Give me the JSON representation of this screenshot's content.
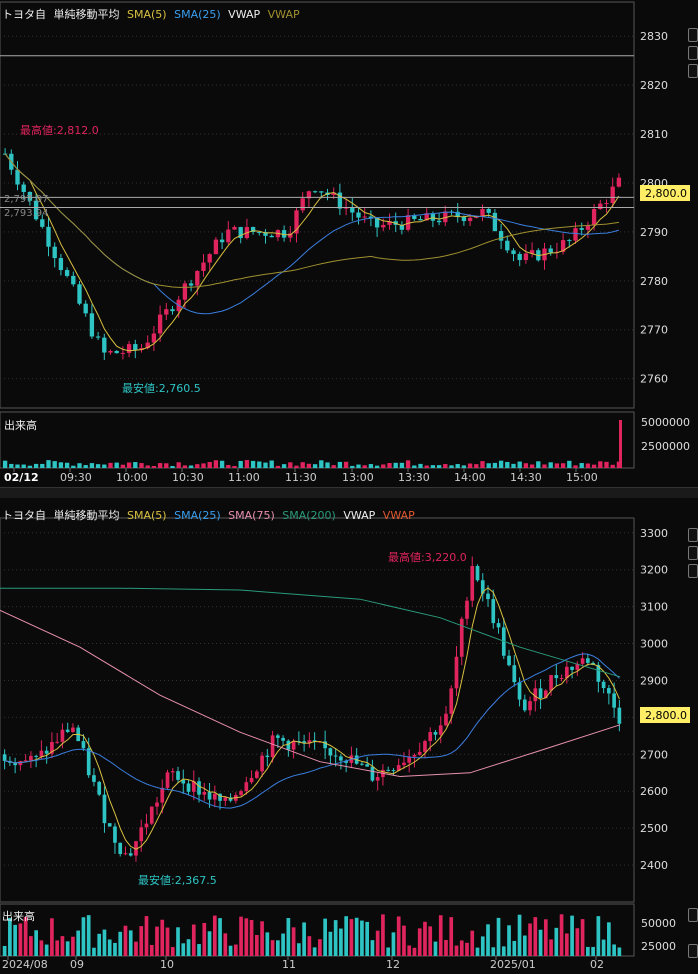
{
  "intraday": {
    "header": {
      "symbol": "トヨタ自",
      "indicator_group": "単純移動平均",
      "sma5": "SMA(5)",
      "sma25": "SMA(25)",
      "vwap1": "VWAP",
      "vwap2": "VWAP"
    },
    "price_ticks": [
      "2830",
      "2820",
      "2810",
      "2800",
      "2790",
      "2780",
      "2770",
      "2760"
    ],
    "current_price": "2,800.0",
    "high_label": "最高値:2,812.0",
    "low_label": "最安値:2,760.5",
    "line_label_1": "2,797.07",
    "line_label_2": "2,793.94",
    "volume_title": "出来高",
    "volume_ticks": [
      "5000000",
      "2500000"
    ],
    "time_ticks": [
      "02/12",
      "09:30",
      "10:00",
      "10:30",
      "11:00",
      "11:30",
      "13:00",
      "13:30",
      "14:00",
      "14:30",
      "15:00"
    ]
  },
  "daily": {
    "header": {
      "symbol": "トヨタ自",
      "indicator_group": "単純移動平均",
      "sma5": "SMA(5)",
      "sma25": "SMA(25)",
      "sma75": "SMA(75)",
      "sma200": "SMA(200)",
      "vwap1": "VWAP",
      "vwap2": "VWAP"
    },
    "price_ticks": [
      "3300",
      "3200",
      "3100",
      "3000",
      "2900",
      "2800",
      "2700",
      "2600",
      "2500",
      "2400"
    ],
    "current_price": "2,800.0",
    "high_label": "最高値:3,220.0",
    "low_label": "最安値:2,367.5",
    "volume_title": "出来高",
    "volume_ticks": [
      "50000",
      "25000"
    ],
    "time_ticks": [
      "2024/08",
      "09",
      "10",
      "11",
      "12",
      "2025/01",
      "02"
    ]
  },
  "colors": {
    "up": "#e0245e",
    "down": "#2ec4c4",
    "sma5": "#d8c040",
    "sma25": "#3a7fe0",
    "sma75": "#e890b0",
    "sma200": "#2a9a7a",
    "vwap": "#a09030",
    "price_badge": "#ffee66"
  }
}
